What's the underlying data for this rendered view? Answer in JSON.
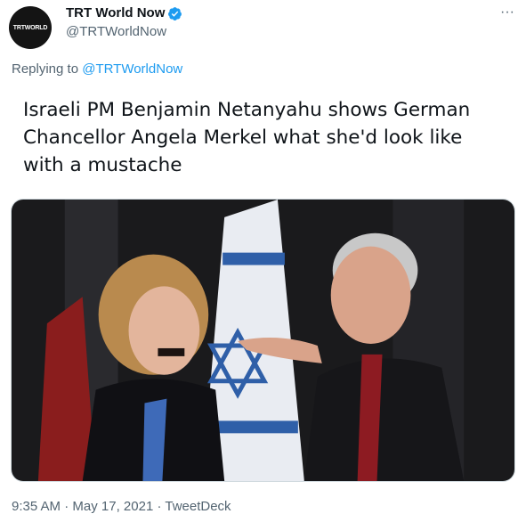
{
  "account": {
    "avatar_text": "TRTWORLD",
    "display_name": "TRT World Now",
    "handle": "@TRTWorldNow"
  },
  "reply": {
    "prefix": "Replying to ",
    "mention": "@TRTWorldNow"
  },
  "tweet": {
    "text": "Israeli PM Benjamin Netanyahu shows German Chancellor Angela Merkel what she'd look like with a mustache"
  },
  "meta": {
    "time": "9:35 AM",
    "separator1": " · ",
    "date": "May 17, 2021",
    "separator2": " · ",
    "source": "TweetDeck"
  },
  "icons": {
    "verified": "verified-badge-icon",
    "more": "more-horizontal-icon"
  },
  "colors": {
    "link": "#1d9bf0",
    "secondary_text": "#536471",
    "primary_text": "#0f1419"
  }
}
